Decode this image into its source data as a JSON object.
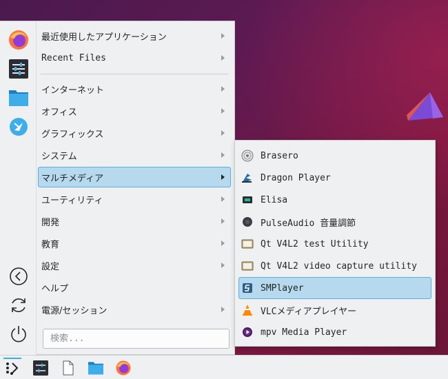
{
  "menu": {
    "items": [
      {
        "label": "最近使用したアプリケーション",
        "submenu": true,
        "mono": false
      },
      {
        "label": "Recent Files",
        "submenu": true,
        "mono": true
      },
      {
        "label": "インターネット",
        "submenu": true,
        "mono": false
      },
      {
        "label": "オフィス",
        "submenu": true,
        "mono": false
      },
      {
        "label": "グラフィックス",
        "submenu": true,
        "mono": false
      },
      {
        "label": "システム",
        "submenu": true,
        "mono": false
      },
      {
        "label": "マルチメディア",
        "submenu": true,
        "mono": false,
        "active": true
      },
      {
        "label": "ユーティリティ",
        "submenu": true,
        "mono": false
      },
      {
        "label": "開発",
        "submenu": true,
        "mono": false
      },
      {
        "label": "教育",
        "submenu": true,
        "mono": false
      },
      {
        "label": "設定",
        "submenu": true,
        "mono": false
      },
      {
        "label": "ヘルプ",
        "submenu": false,
        "mono": false
      },
      {
        "label": "電源/セッション",
        "submenu": true,
        "mono": false
      }
    ],
    "search": {
      "placeholder": "検索..."
    },
    "favorites": [
      "firefox-icon",
      "system-settings-icon",
      "file-manager-icon",
      "discover-icon"
    ],
    "session_buttons": [
      "logout-icon",
      "restart-icon",
      "shutdown-icon"
    ]
  },
  "submenu": {
    "items": [
      {
        "label": "Brasero",
        "icon": "disc-icon"
      },
      {
        "label": "Dragon Player",
        "icon": "dragon-player-icon"
      },
      {
        "label": "Elisa",
        "icon": "elisa-icon"
      },
      {
        "label": "PulseAudio 音量調節",
        "icon": "pulseaudio-icon"
      },
      {
        "label": "Qt V4L2 test Utility",
        "icon": "qv4l2-icon"
      },
      {
        "label": "Qt V4L2 video capture utility",
        "icon": "qvidcap-icon"
      },
      {
        "label": "SMPlayer",
        "icon": "smplayer-icon",
        "active": true
      },
      {
        "label": "VLCメディアプレイヤー",
        "icon": "vlc-icon"
      },
      {
        "label": "mpv Media Player",
        "icon": "mpv-icon"
      }
    ]
  },
  "taskbar": {
    "items": [
      "application-launcher-icon",
      "system-settings-icon",
      "document-icon",
      "file-manager-icon",
      "firefox-icon"
    ]
  },
  "colors": {
    "highlight": "#b6d9ed",
    "highlight_border": "#5aaedc",
    "panel": "#eff0f1",
    "accent": "#3daee9"
  }
}
